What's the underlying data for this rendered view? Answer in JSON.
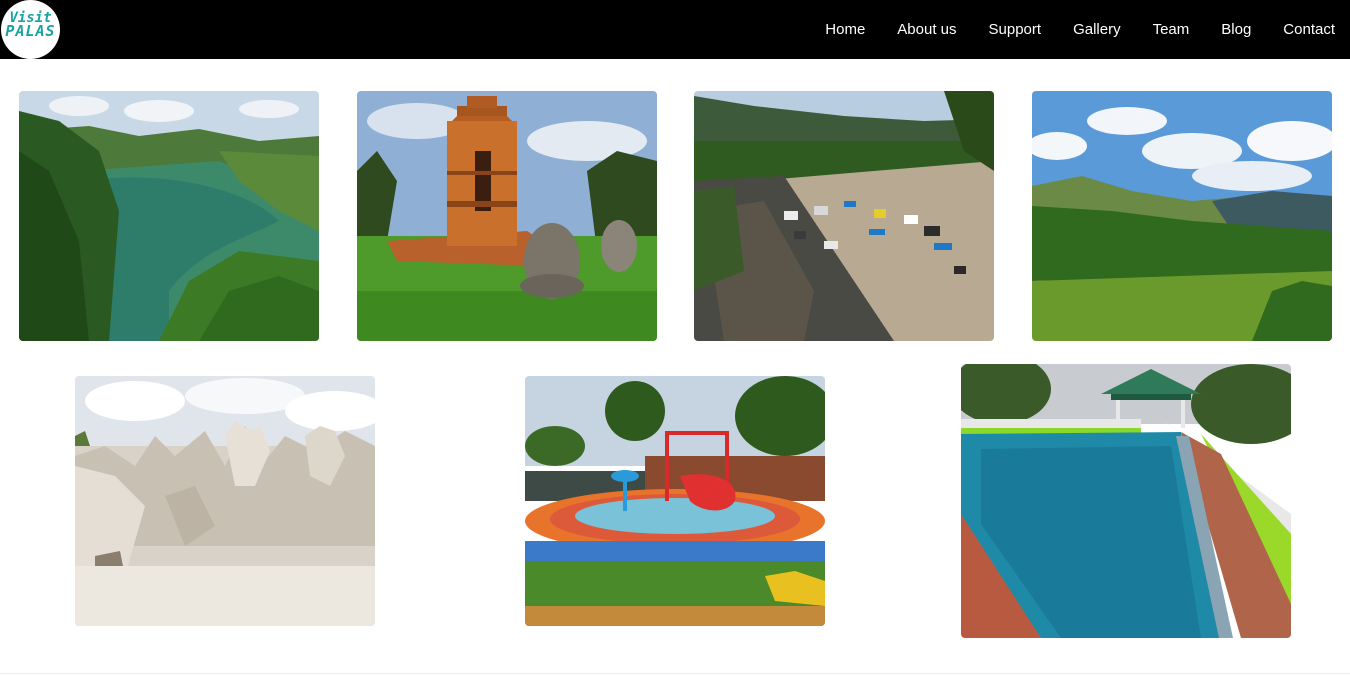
{
  "brand": {
    "line1": "Visit",
    "line2": "PALAS"
  },
  "nav": {
    "items": [
      {
        "label": "Home"
      },
      {
        "label": "About us"
      },
      {
        "label": "Support"
      },
      {
        "label": "Gallery"
      },
      {
        "label": "Team"
      },
      {
        "label": "Blog"
      },
      {
        "label": "Contact"
      }
    ]
  },
  "colors": {
    "navbar_bg": "#000000",
    "nav_text": "#ffffff",
    "logo_text": "#1aa3a0",
    "page_bg": "#ffffff"
  },
  "gallery": {
    "images": [
      {
        "subject": "green lake in forested valley"
      },
      {
        "subject": "ancient brick temple with stone statues"
      },
      {
        "subject": "river with parked cars and tents"
      },
      {
        "subject": "lake with green hills and cloudy sky"
      },
      {
        "subject": "white eroded rock formations"
      },
      {
        "subject": "water park playground with fountains"
      },
      {
        "subject": "swimming pool with green gazebo"
      }
    ]
  }
}
